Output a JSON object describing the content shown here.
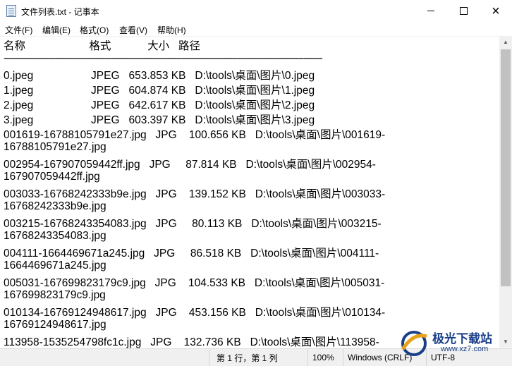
{
  "window": {
    "title": "文件列表.txt - 记事本",
    "controls": {
      "minimize": "minimize",
      "maximize": "maximize",
      "close": "×"
    }
  },
  "menu": [
    "文件(F)",
    "编辑(E)",
    "格式(O)",
    "查看(V)",
    "帮助(H)"
  ],
  "editor": {
    "lines": [
      "名称                     格式            大小   路径",
      "------------------------------------------------------------------------------------------------------------------------",
      "0.jpeg                   JPEG   653.853 KB   D:\\tools\\桌面\\图片\\0.jpeg",
      "1.jpeg                   JPEG   604.874 KB   D:\\tools\\桌面\\图片\\1.jpeg",
      "2.jpeg                   JPEG   642.617 KB   D:\\tools\\桌面\\图片\\2.jpeg",
      "3.jpeg                   JPEG   603.397 KB   D:\\tools\\桌面\\图片\\3.jpeg",
      "001619-16788105791e27.jpg   JPG    100.656 KB   D:\\tools\\桌面\\图片\\001619-",
      "16788105791e27.jpg",
      "002954-167907059442ff.jpg   JPG     87.814 KB   D:\\tools\\桌面\\图片\\002954-",
      "167907059442ff.jpg",
      "003033-16768242333b9e.jpg   JPG    139.152 KB   D:\\tools\\桌面\\图片\\003033-",
      "16768242333b9e.jpg",
      "003215-16768243354083.jpg   JPG     80.113 KB   D:\\tools\\桌面\\图片\\003215-",
      "16768243354083.jpg",
      "004111-1664469671a245.jpg   JPG     86.518 KB   D:\\tools\\桌面\\图片\\004111-",
      "1664469671a245.jpg",
      "005031-167699823179c9.jpg   JPG    104.533 KB   D:\\tools\\桌面\\图片\\005031-",
      "167699823179c9.jpg",
      "010134-16769124948617.jpg   JPG    453.156 KB   D:\\tools\\桌面\\图片\\010134-",
      "16769124948617.jpg",
      "113958-1535254798fc1c.jpg   JPG    132.736 KB   D:\\tools\\桌面\\图片\\113958-"
    ]
  },
  "statusbar": {
    "position": "第 1 行，第 1 列",
    "zoom": "100%",
    "line_ending": "Windows (CRLF)",
    "encoding": "UTF-8"
  },
  "watermark": {
    "name": "极光下载站",
    "url": "www.xz7.com"
  },
  "colors": {
    "watermark": "#1a3f8a",
    "statusbar": "#f0f0f0",
    "scroll_thumb": "#c1c1c1"
  }
}
